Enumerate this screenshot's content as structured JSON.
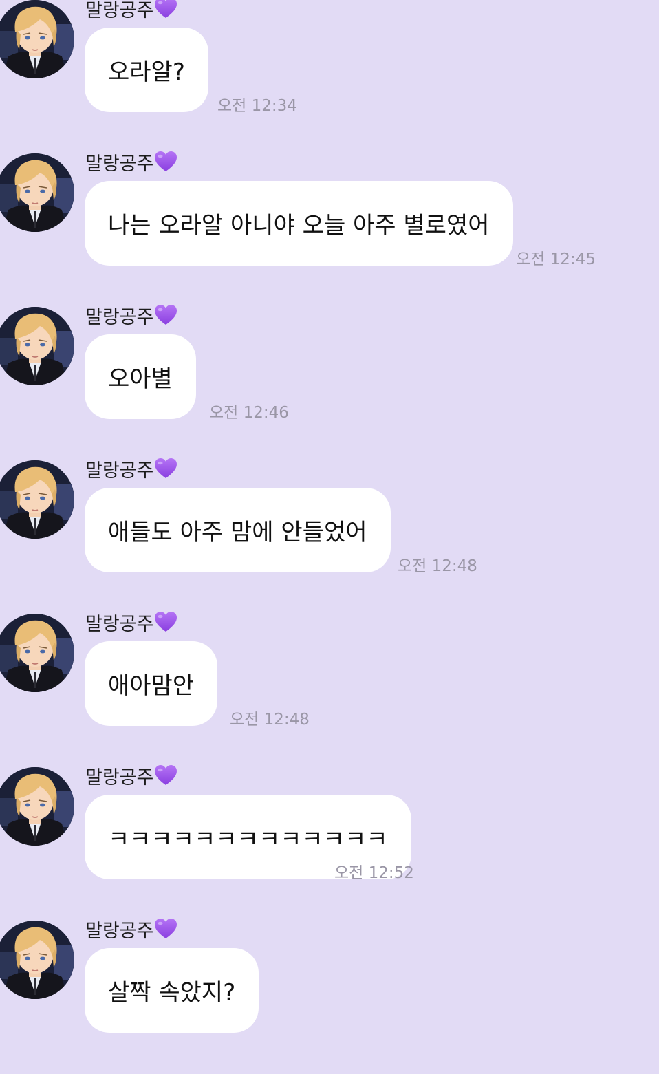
{
  "colors": {
    "background": "#e2dbf5",
    "bubble": "#ffffff",
    "timestamp": "#9a96a6",
    "heart": "#9b4de8"
  },
  "sender_icon": "purple-heart-icon",
  "avatar_icon": "profile-avatar-icon",
  "messages": [
    {
      "sender": "말랑공주",
      "text": "오라알?",
      "time": "오전 12:34"
    },
    {
      "sender": "말랑공주",
      "text": "나는 오라알 아니야 오늘 아주 별로였어",
      "time": "오전 12:45"
    },
    {
      "sender": "말랑공주",
      "text": "오아별",
      "time": "오전 12:46"
    },
    {
      "sender": "말랑공주",
      "text": "애들도 아주 맘에 안들었어",
      "time": "오전 12:48"
    },
    {
      "sender": "말랑공주",
      "text": "애아맘안",
      "time": "오전 12:48"
    },
    {
      "sender": "말랑공주",
      "text": "ㅋㅋㅋㅋㅋㅋㅋㅋㅋㅋㅋㅋㅋ",
      "time": "오전 12:52"
    },
    {
      "sender": "말랑공주",
      "text": "살짝 속았지?",
      "time": ""
    }
  ]
}
